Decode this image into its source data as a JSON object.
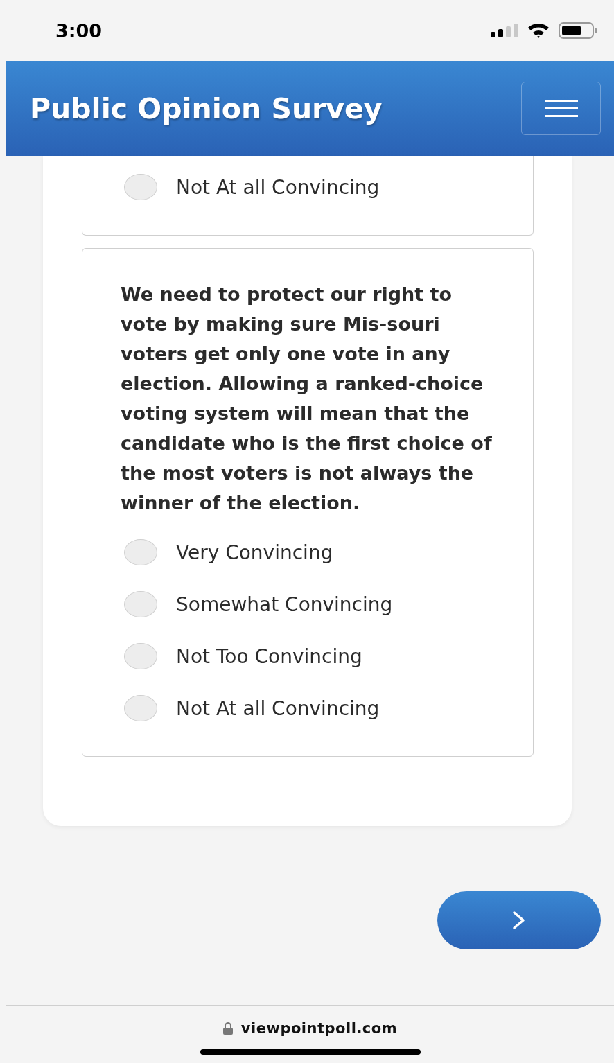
{
  "status_bar": {
    "time": "3:00"
  },
  "header": {
    "title": "Public Opinion Survey"
  },
  "questions": [
    {
      "options": [
        {
          "label": "Not At all Convincing",
          "selected": false
        }
      ]
    },
    {
      "prompt": "We need to protect our right to vote by making sure Mis-souri voters get only one vote in any election. Allowing a ranked-choice voting system will mean that the candidate who is the first choice of the most voters is not always the winner of the election.",
      "options": [
        {
          "label": "Very Convincing",
          "selected": false
        },
        {
          "label": "Somewhat Convincing",
          "selected": false
        },
        {
          "label": "Not Too Convincing",
          "selected": false
        },
        {
          "label": "Not At all Convincing",
          "selected": false
        }
      ]
    }
  ],
  "browser": {
    "url": "viewpointpoll.com"
  }
}
